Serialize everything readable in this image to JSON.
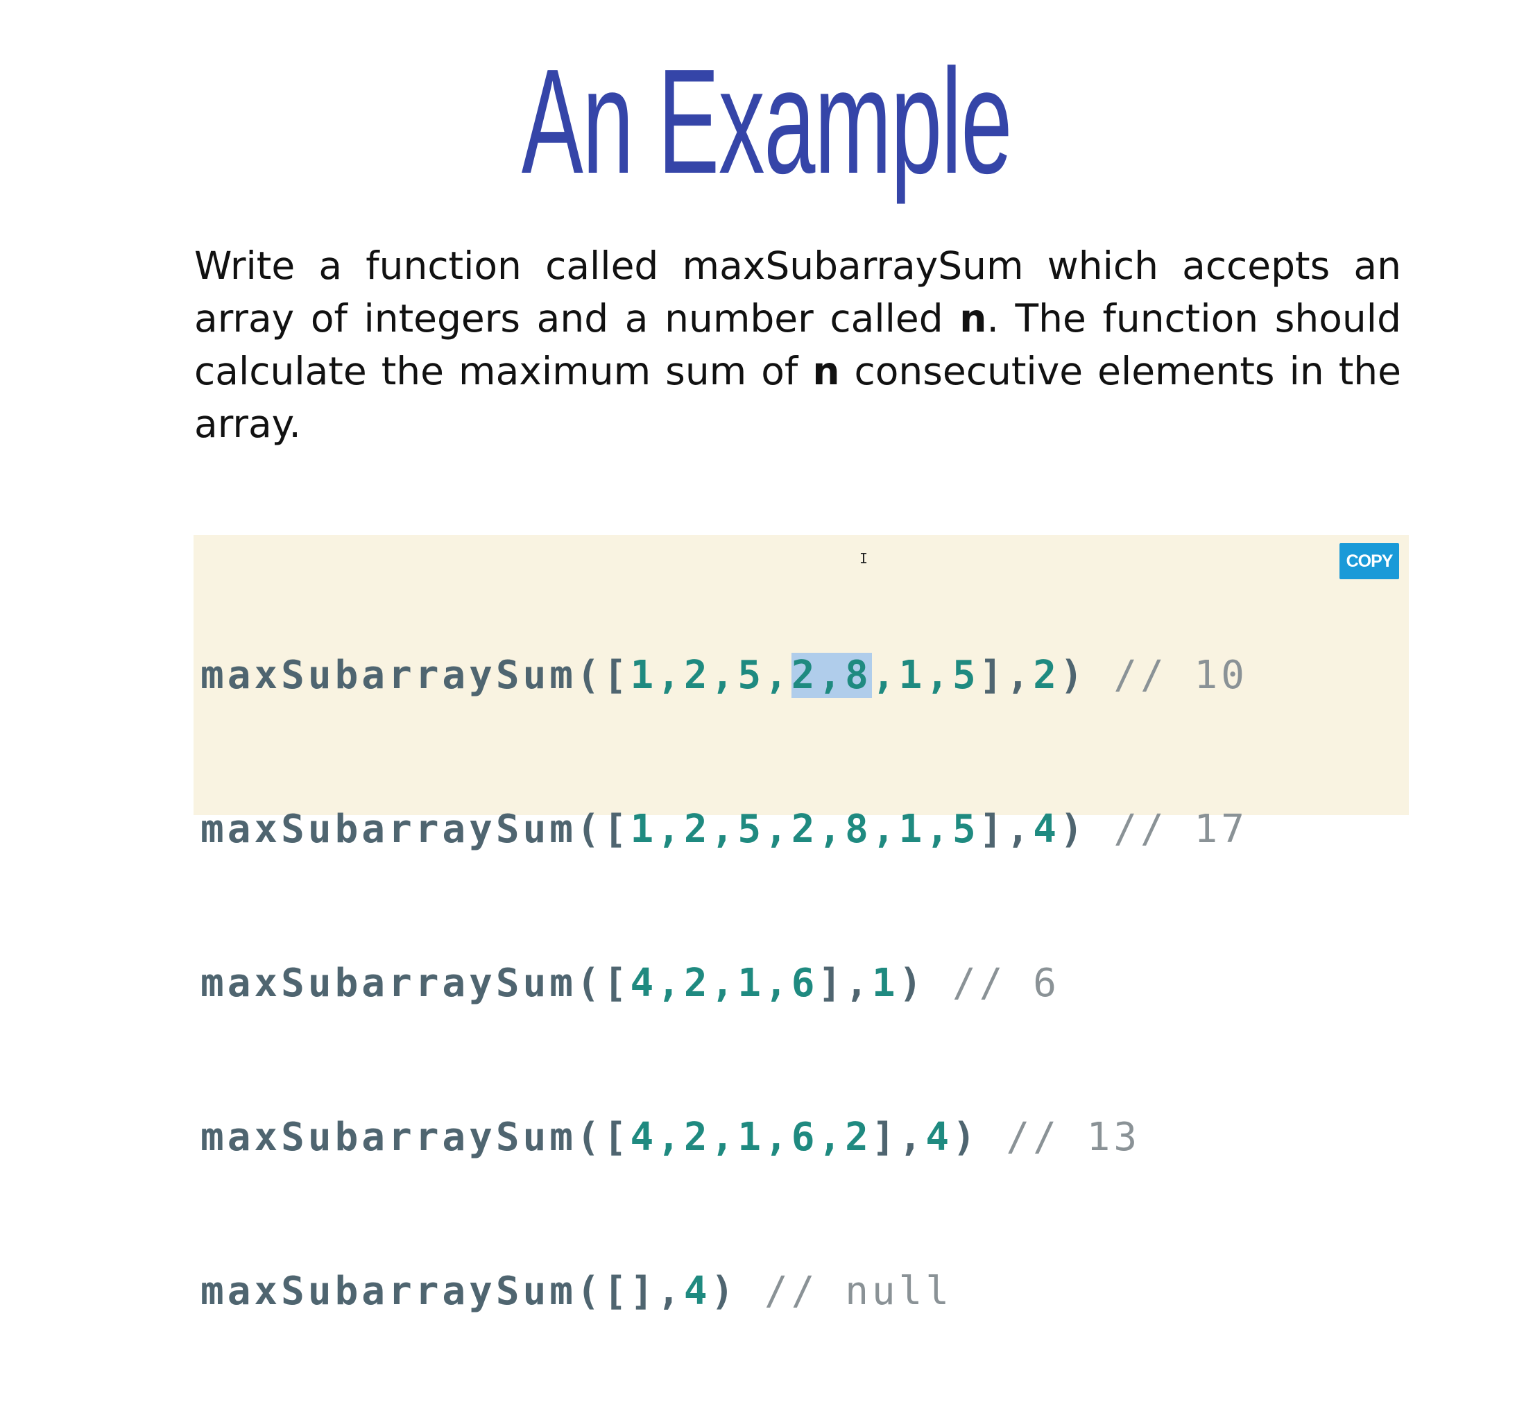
{
  "title": "An Example",
  "description": {
    "part1": "Write a function called maxSubarraySum which accepts an array of integers and a number called ",
    "bold1": "n",
    "part2": ". The function should calculate the maximum sum of ",
    "bold2": "n",
    "part3": " consecutive elements in the array."
  },
  "copy_button": "COPY",
  "code_lines": [
    {
      "fn": "maxSubarraySum",
      "open": "([",
      "nums_before": "1,2,5,",
      "selected": "2,8",
      "nums_after": ",1,5",
      "close": "],",
      "n": "2",
      "end": ")",
      "comment": " // 10"
    },
    {
      "fn": "maxSubarraySum",
      "open": "([",
      "nums": "1,2,5,2,8,1,5",
      "close": "],",
      "n": "4",
      "end": ")",
      "comment": " // 17"
    },
    {
      "fn": "maxSubarraySum",
      "open": "([",
      "nums": "4,2,1,6",
      "close": "],",
      "n": "1",
      "end": ")",
      "comment": " // 6"
    },
    {
      "fn": "maxSubarraySum",
      "open": "([",
      "nums": "4,2,1,6,2",
      "close": "],",
      "n": "4",
      "end": ")",
      "comment": " // 13"
    },
    {
      "fn": "maxSubarraySum",
      "open": "([",
      "nums": "",
      "close": "],",
      "n": "4",
      "end": ")",
      "comment": " // null"
    }
  ],
  "colors": {
    "title": "#3545a8",
    "code_background": "#f9f3e1",
    "function_name": "#4f6570",
    "number": "#1f8a80",
    "comment": "#8a9296",
    "copy_button": "#1a9ad8",
    "selection": "#b0cdeb"
  }
}
